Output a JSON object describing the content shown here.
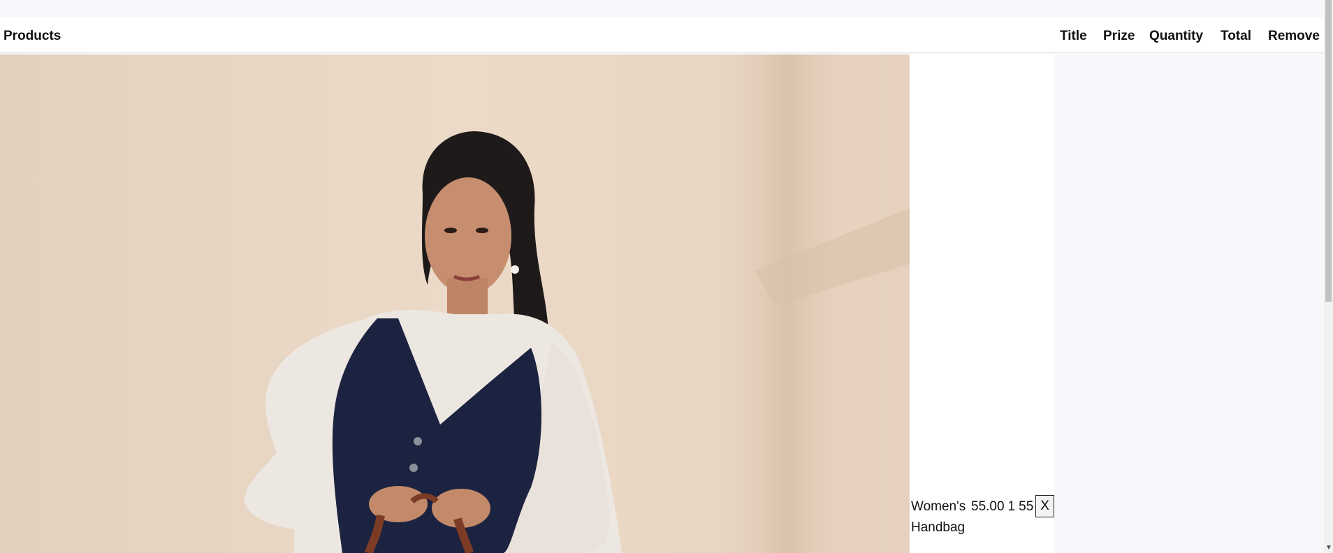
{
  "header": {
    "products_label": "Products",
    "columns": [
      "Title",
      "Prize",
      "Quantity",
      "Total",
      "Remove"
    ]
  },
  "product": {
    "image_alt": "Woman in navy vest and white top holding a brown handbag"
  },
  "cart": {
    "rows": [
      {
        "title": "Women's Handbag",
        "price": "55.00",
        "quantity": "1",
        "total": "55",
        "remove_label": "X"
      }
    ]
  },
  "icons": {
    "scroll_down": "chevron-down-icon"
  },
  "colors": {
    "page_bg": "#f7f8fb",
    "header_bg": "#ffffff",
    "vest": "#1c2340",
    "top": "#ece7e0",
    "bag": "#7b3b25"
  }
}
